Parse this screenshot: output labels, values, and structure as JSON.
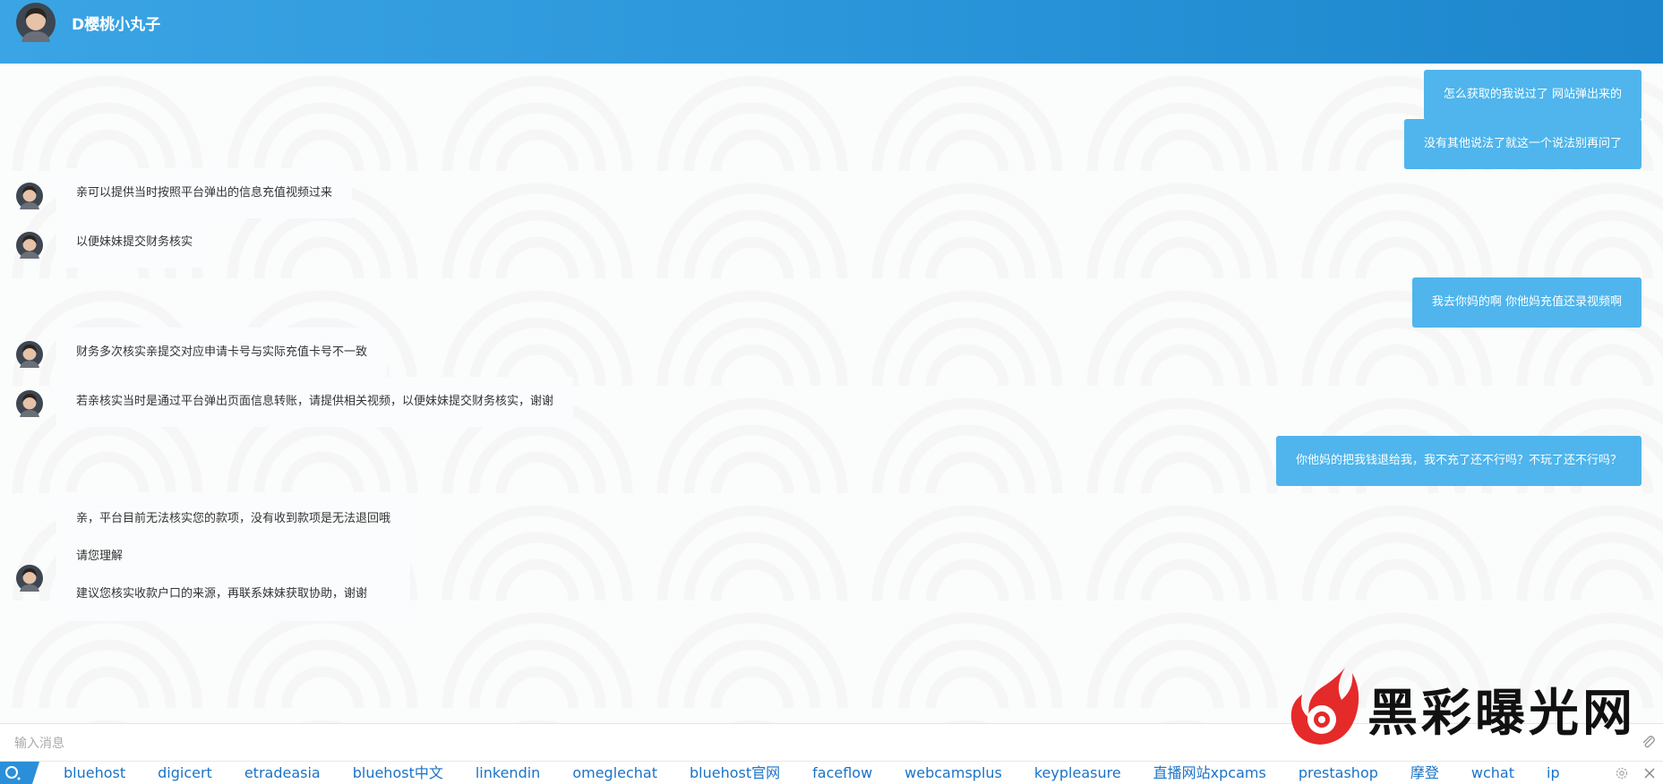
{
  "header": {
    "title": "D樱桃小丸子"
  },
  "messages": {
    "m1": "怎么获取的我说过了 网站弹出来的",
    "m2": "没有其他说法了就这一个说法别再问了",
    "m3": "亲可以提供当时按照平台弹出的信息充值视频过来",
    "m4": "以便妹妹提交财务核实",
    "m5": "我去你妈的啊 你他妈充值还录视频啊",
    "m6": "财务多次核实亲提交对应申请卡号与实际充值卡号不一致",
    "m7": "若亲核实当时是通过平台弹出页面信息转账，请提供相关视频，以便妹妹提交财务核实，谢谢",
    "m8": "你他妈的把我钱退给我，我不充了还不行吗？不玩了还不行吗？",
    "m9": {
      "line1": "亲，平台目前无法核实您的款项，没有收到款项是无法退回哦",
      "line2": "请您理解",
      "line3": "建议您核实收款户口的来源，再联系妹妹获取协助，谢谢"
    }
  },
  "input": {
    "placeholder": "输入消息",
    "value": ""
  },
  "watermark": {
    "text": "黑彩曝光网"
  },
  "footer": {
    "links": [
      "bluehost",
      "digicert",
      "etradeasia",
      "bluehost中文",
      "linkendin",
      "omeglechat",
      "bluehost官网",
      "faceflow",
      "webcamsplus",
      "keypleasure",
      "直播网站xpcams",
      "prestashop",
      "摩登",
      "wchat",
      "ip"
    ]
  },
  "colors": {
    "header": "#2b97dc",
    "outgoing_bubble": "#4fb5ec",
    "link": "#1a73c8"
  },
  "icons": [
    "avatar",
    "attach-icon",
    "gear-icon",
    "close-icon",
    "search-tab-icon",
    "watermark-logo"
  ]
}
